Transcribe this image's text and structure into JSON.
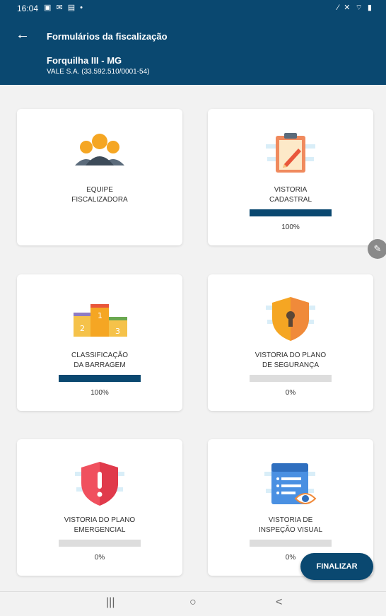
{
  "status_bar": {
    "time": "16:04",
    "left_icons": "▣ ✉ ▤ •",
    "right_icons": "⁄ ✕ ⌔ ▮"
  },
  "header": {
    "title": "Formulários da fiscalização",
    "subtitle": "Forquilha III - MG",
    "company": "VALE S.A. (33.592.510/0001-54)"
  },
  "cards": [
    {
      "label": "EQUIPE\nFISCALIZADORA",
      "icon": "team-icon",
      "has_progress": false
    },
    {
      "label": "VISTORIA\nCADASTRAL",
      "icon": "clipboard-pencil-icon",
      "has_progress": true,
      "progress": 100,
      "progress_text": "100%"
    },
    {
      "label": "CLASSIFICAÇÃO\nDA BARRAGEM",
      "icon": "podium-icon",
      "has_progress": true,
      "progress": 100,
      "progress_text": "100%"
    },
    {
      "label": "VISTORIA DO PLANO\nDE SEGURANÇA",
      "icon": "shield-lock-icon",
      "has_progress": true,
      "progress": 0,
      "progress_text": "0%"
    },
    {
      "label": "VISTORIA DO PLANO\nEMERGENCIAL",
      "icon": "shield-alert-icon",
      "has_progress": true,
      "progress": 0,
      "progress_text": "0%"
    },
    {
      "label": "VISTORIA DE\nINSPEÇÃO VISUAL",
      "icon": "form-eye-icon",
      "has_progress": true,
      "progress": 0,
      "progress_text": "0%"
    }
  ],
  "finalize_label": "FINALIZAR",
  "nav": {
    "recent": "|||",
    "home": "○",
    "back": "<"
  },
  "colors": {
    "primary": "#0a4870",
    "progress_track": "#dddddd",
    "fab_gray": "#8a8a8a"
  }
}
